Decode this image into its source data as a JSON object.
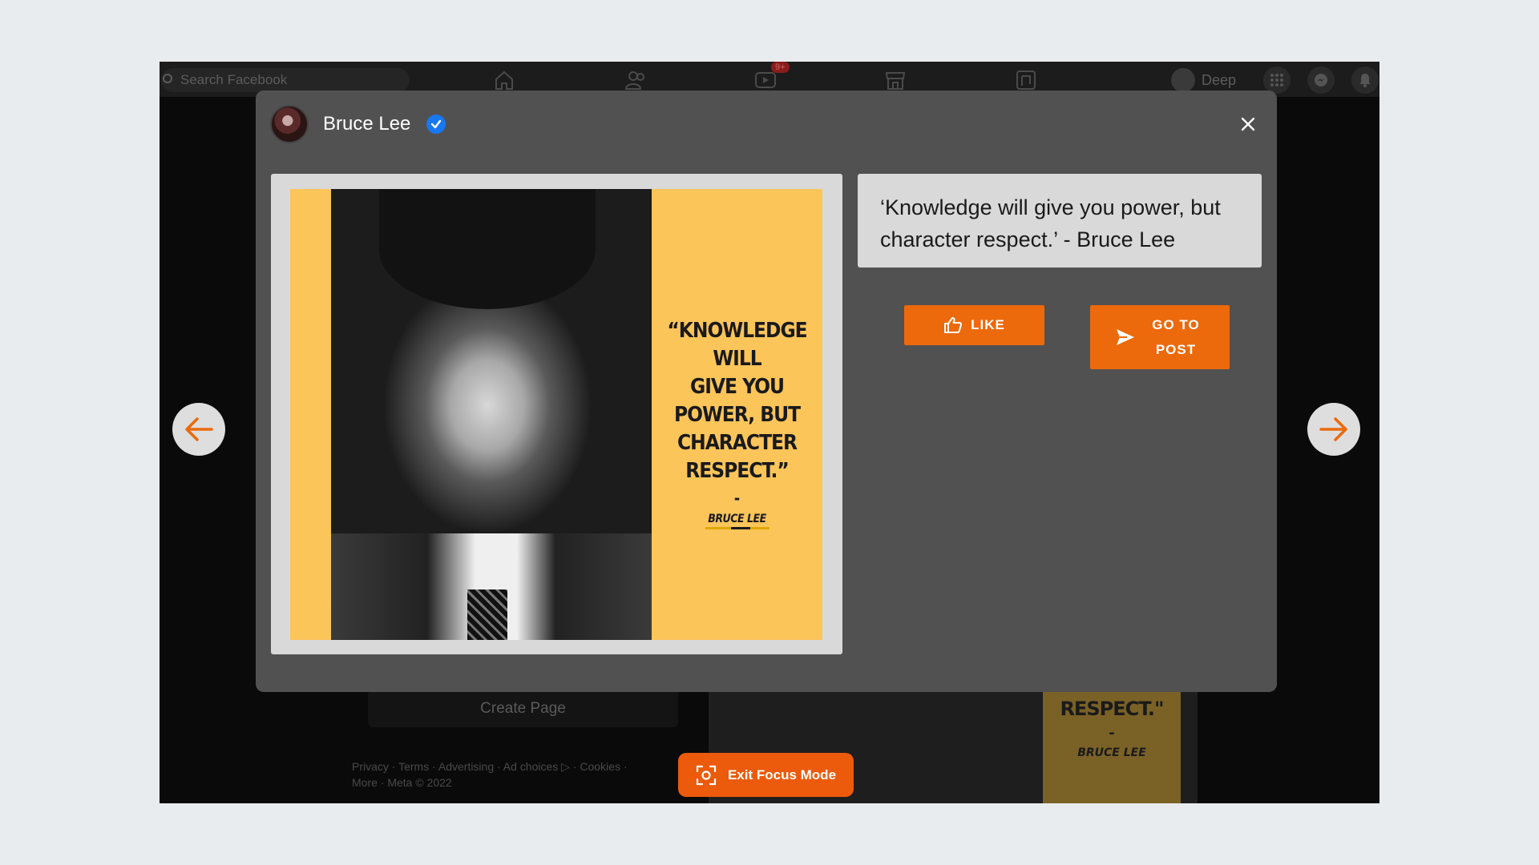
{
  "background_page": {
    "search_placeholder": "Search Facebook",
    "notification_badge": "9+",
    "profile_name": "Deep",
    "create_page_label": "Create Page",
    "footer_line1": "Privacy · Terms · Advertising · Ad choices ▷ · Cookies ·",
    "footer_line2": "More · Meta © 2022",
    "poster_quote": "RESPECT.\"",
    "poster_dash": "-",
    "poster_name": "BRUCE LEE"
  },
  "modal": {
    "author_name": "Bruce Lee",
    "verified": true,
    "image": {
      "poster_quote": "“KNOWLEDGE\nWILL\nGIVE YOU\nPOWER, BUT\nCHARACTER\nRESPECT.”",
      "poster_dash": "-",
      "poster_name": "BRUCE LEE"
    },
    "quote_text": "‘Knowledge will give you power, but character respect.’ - Bruce Lee",
    "like_label": "LIKE",
    "goto_label": "GO TO POST"
  },
  "focus_mode": {
    "exit_label": "Exit Focus Mode"
  },
  "colors": {
    "accent": "#ec6a0c",
    "modal_bg": "#515151",
    "panel_bg": "#d9d9d9",
    "poster_yellow": "#fcc55a",
    "verified_blue": "#1877f2"
  },
  "icons": [
    "search-icon",
    "home-icon",
    "friends-icon",
    "video-icon",
    "marketplace-icon",
    "gaming-icon",
    "menu-grid-icon",
    "messenger-icon",
    "bell-icon",
    "verified-badge-icon",
    "close-icon",
    "thumbs-up-icon",
    "send-icon",
    "arrow-left-icon",
    "arrow-right-icon",
    "focus-icon"
  ]
}
